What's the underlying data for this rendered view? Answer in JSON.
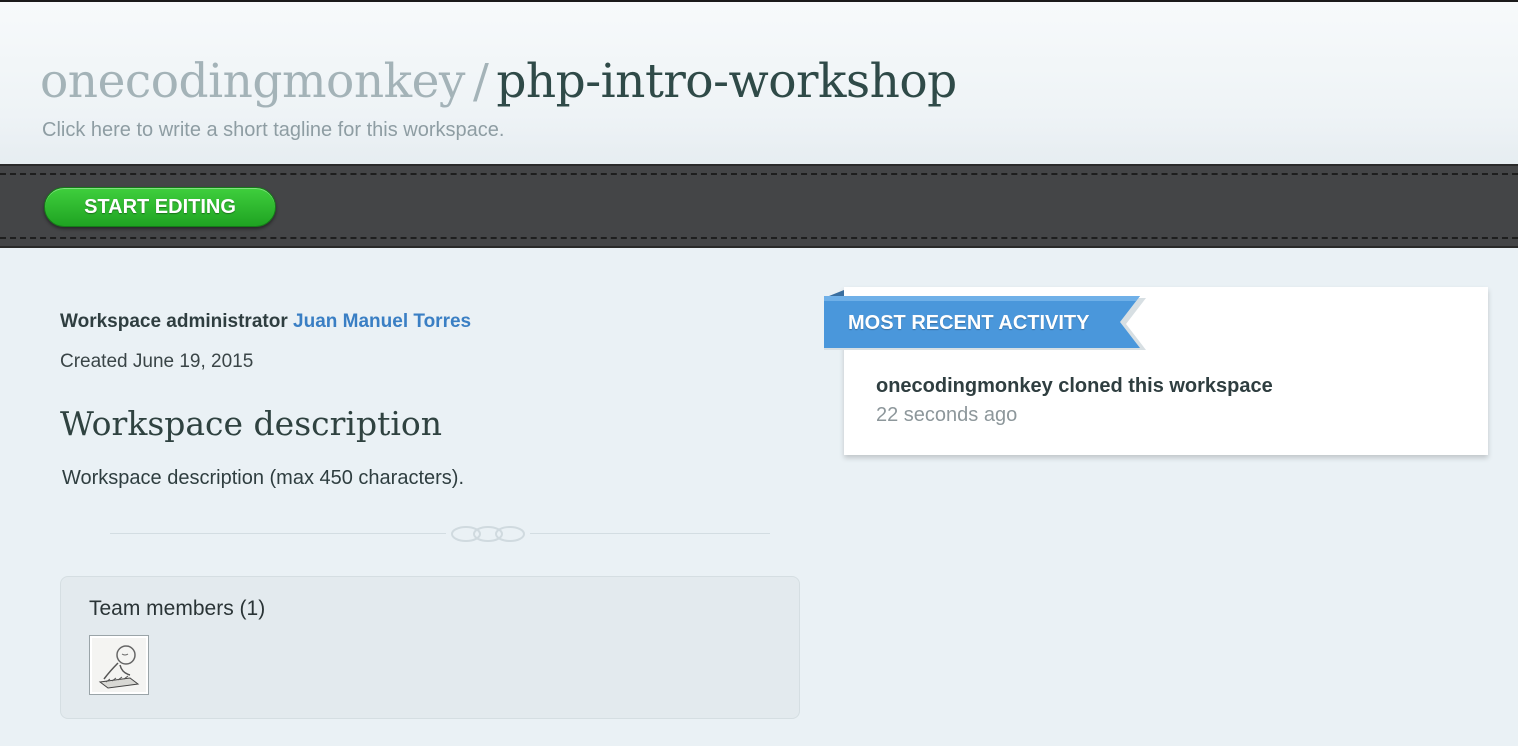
{
  "header": {
    "owner": "onecodingmonkey",
    "separator": "/",
    "workspace": "php-intro-workshop",
    "tagline": "Click here to write a short tagline for this workspace."
  },
  "toolbar": {
    "start_editing_label": "START EDITING"
  },
  "workspace_info": {
    "admin_label": "Workspace administrator",
    "admin_name": "Juan Manuel Torres",
    "created": "Created June 19, 2015",
    "description_heading": "Workspace description",
    "description_text": "Workspace description (max 450 characters)."
  },
  "team": {
    "title": "Team members (1)"
  },
  "activity": {
    "ribbon_label": "MOST RECENT ACTIVITY",
    "items": [
      {
        "text": "onecodingmonkey cloned this workspace",
        "time": "22 seconds ago"
      }
    ]
  },
  "colors": {
    "accent_green": "#2db82f",
    "link_blue": "#3a7fc4",
    "ribbon_blue": "#4a97db",
    "toolbar_dark": "#444547"
  }
}
